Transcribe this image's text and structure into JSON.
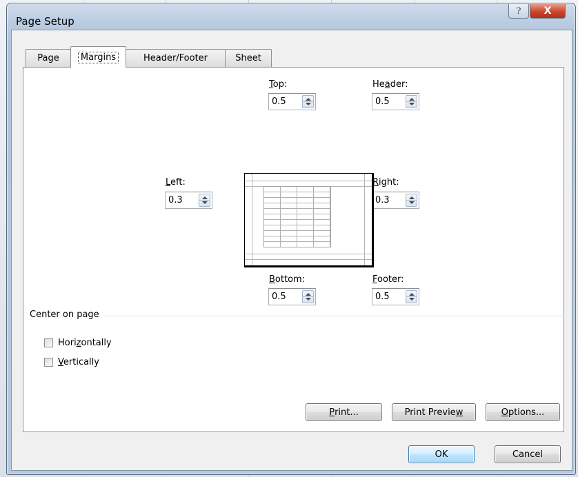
{
  "dialog": {
    "title": "Page Setup",
    "help_glyph": "?",
    "close_glyph": "X"
  },
  "tabs": [
    {
      "label": "Page",
      "active": false
    },
    {
      "label": "Margins",
      "active": true
    },
    {
      "label": "Header/Footer",
      "active": false
    },
    {
      "label": "Sheet",
      "active": false
    }
  ],
  "margins": {
    "top": {
      "pre": "",
      "mnemonic": "T",
      "post": "op:",
      "value": "0.5"
    },
    "header": {
      "pre": "He",
      "mnemonic": "a",
      "post": "der:",
      "value": "0.5"
    },
    "left": {
      "pre": "",
      "mnemonic": "L",
      "post": "eft:",
      "value": "0.3"
    },
    "right": {
      "pre": "",
      "mnemonic": "R",
      "post": "ight:",
      "value": "0.3"
    },
    "bottom": {
      "pre": "",
      "mnemonic": "B",
      "post": "ottom:",
      "value": "0.5"
    },
    "footer": {
      "pre": "",
      "mnemonic": "F",
      "post": "ooter:",
      "value": "0.5"
    }
  },
  "center_on_page": {
    "title": "Center on page",
    "horizontally": {
      "pre": "Hori",
      "mnemonic": "z",
      "post": "ontally",
      "checked": false
    },
    "vertically": {
      "pre": "",
      "mnemonic": "V",
      "post": "ertically",
      "checked": false
    }
  },
  "buttons": {
    "print": {
      "pre": "",
      "mnemonic": "P",
      "post": "rint..."
    },
    "preview": {
      "pre": "Print Previe",
      "mnemonic": "w",
      "post": ""
    },
    "options": {
      "pre": "",
      "mnemonic": "O",
      "post": "ptions..."
    },
    "ok": "OK",
    "cancel": "Cancel"
  },
  "colors": {
    "frame": "#b9cbe0",
    "close_button": "#c9452c",
    "default_button": "#a7d9f5"
  }
}
